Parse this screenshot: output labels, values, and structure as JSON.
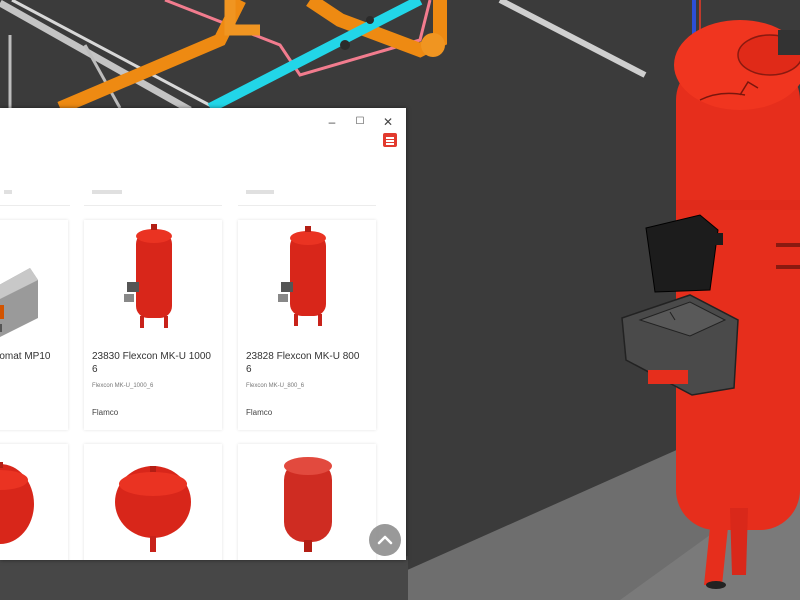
{
  "window": {
    "minimize_glyph": "–",
    "maximize_glyph": "☐",
    "close_glyph": "✕"
  },
  "products": [
    {
      "title": "romat MP10",
      "code": "",
      "brand": "",
      "icon": "pump-unit-icon"
    },
    {
      "title": "23830 Flexcon MK-U 1000 6",
      "code": "Flexcon MK-U_1000_6",
      "brand": "Flamco",
      "icon": "tall-expansion-vessel-icon"
    },
    {
      "title": "23828 Flexcon MK-U 800 6",
      "code": "Flexcon MK-U_800_6",
      "brand": "Flamco",
      "icon": "tall-expansion-vessel-icon"
    },
    {
      "title": "",
      "code": "",
      "brand": "",
      "icon": "round-expansion-vessel-icon"
    },
    {
      "title": "",
      "code": "",
      "brand": "",
      "icon": "round-expansion-vessel-icon"
    },
    {
      "title": "",
      "code": "",
      "brand": "",
      "icon": "cylinder-vessel-icon"
    }
  ],
  "colors": {
    "vessel_red": "#e62e1c",
    "pipe_orange": "#ee8a12",
    "pipe_cyan": "#22d6e8",
    "background": "#3b3b3b",
    "accent": "#e23a2e"
  }
}
